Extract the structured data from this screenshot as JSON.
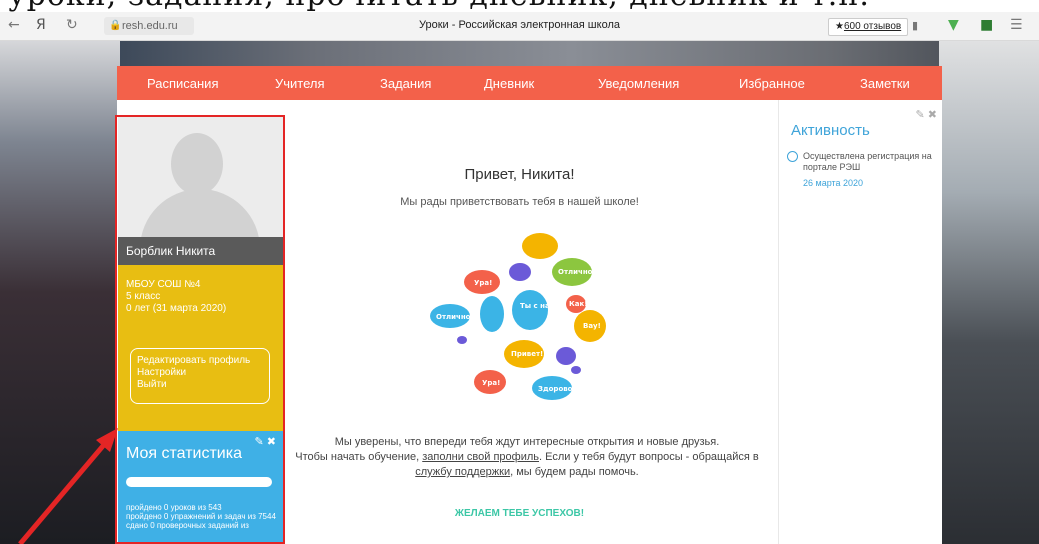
{
  "caption": {
    "text": "уроки, задания, прочитать дневник, дневник и т.п."
  },
  "browser": {
    "back": "←",
    "yandex": "Я",
    "reload": "↻",
    "url": "resh.edu.ru",
    "page_title": "Уроки - Российская электронная школа",
    "reviews_star": "★",
    "reviews_label": "600 отзывов"
  },
  "nav": {
    "items": [
      "Расписания",
      "Учителя",
      "Задания",
      "Дневник",
      "Уведомления",
      "Избранное",
      "Заметки"
    ]
  },
  "profile": {
    "name": "Борблик Никита",
    "school_lines": [
      "МБОУ СОШ №4",
      "5 класс",
      "0 лет (31 марта 2020)"
    ],
    "actions": [
      "Редактировать профиль",
      "Настройки",
      "Выйти"
    ]
  },
  "stats": {
    "title": "Моя статистика",
    "tools": "✎ ✖",
    "lines": [
      "пройдено 0 уроков из 543",
      "пройдено 0 упражнений и задач из 7544",
      "сдано 0 проверочных заданий из"
    ]
  },
  "main": {
    "greeting": "Привет, Никита!",
    "subgreeting": "Мы рады приветствовать тебя в нашей школе!",
    "msg_line1": "Мы уверены, что впереди тебя ждут интересные открытия и новые друзья.",
    "msg_line2_pre": "Чтобы начать обучение, ",
    "msg_link1": "заполни свой профиль",
    "msg_line2_post": ". Если у тебя будут вопросы - обращайся в",
    "msg_link2": "службу поддержки",
    "msg_line3_post": ", мы будем рады помочь.",
    "wish": "ЖЕЛАЕМ ТЕБЕ УСПЕХОВ!"
  },
  "bubbles": [
    {
      "text": "Ура!",
      "color": "#f3614a"
    },
    {
      "text": "Отлично!",
      "color": "#3bb4e6"
    },
    {
      "text": "Ты с нами!",
      "color": "#3bb4e6"
    },
    {
      "text": "Отлично!",
      "color": "#8cc63f"
    },
    {
      "text": "Как!",
      "color": "#f3614a"
    },
    {
      "text": "Вау!",
      "color": "#f3614a"
    },
    {
      "text": "Привет!",
      "color": "#f4b400"
    },
    {
      "text": "Ура!",
      "color": "#f3614a"
    },
    {
      "text": "Здорово!",
      "color": "#3bb4e6"
    }
  ],
  "activity": {
    "tools": "✎ ✖",
    "title": "Активность",
    "entry_text": "Осуществлена регистрация на портале РЭШ",
    "entry_date": "26 марта 2020"
  }
}
